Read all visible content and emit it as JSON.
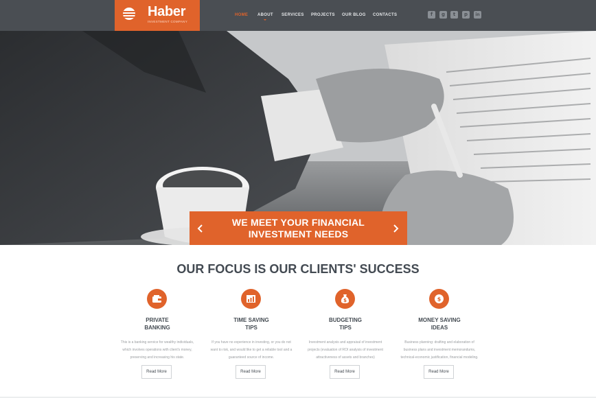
{
  "brand": {
    "name": "Haber",
    "tagline": "INVESTMENT COMPANY",
    "accent": "#e0632b",
    "header_bg": "#4a4e53"
  },
  "nav": [
    {
      "label": "HOME",
      "active": true
    },
    {
      "label": "ABOUT",
      "active": false
    },
    {
      "label": "SERVICES",
      "active": false
    },
    {
      "label": "PROJECTS",
      "active": false
    },
    {
      "label": "OUR BLOG",
      "active": false
    },
    {
      "label": "CONTACTS",
      "active": false
    }
  ],
  "social": [
    {
      "icon": "facebook-icon",
      "glyph": "f"
    },
    {
      "icon": "google-plus-icon",
      "glyph": "g"
    },
    {
      "icon": "twitter-icon",
      "glyph": "t"
    },
    {
      "icon": "pinterest-icon",
      "glyph": "p"
    },
    {
      "icon": "linkedin-icon",
      "glyph": "in"
    }
  ],
  "hero": {
    "line1": "WE MEET YOUR FINANCIAL",
    "line2": "INVESTMENT NEEDS",
    "prev_icon": "chevron-left-icon",
    "next_icon": "chevron-right-icon"
  },
  "focus": {
    "title": "OUR FOCUS IS OUR CLIENTS' SUCCESS",
    "items": [
      {
        "icon": "wallet-icon",
        "title1": "PRIVATE",
        "title2": "BANKING",
        "desc1": "This is a banking service for wealthy individuals,",
        "desc2": "which involves operations with client's money,",
        "desc3": "preserving and increasing his state.",
        "button": "Read More"
      },
      {
        "icon": "bar-chart-icon",
        "title1": "TIME SAVING",
        "title2": "TIPS",
        "desc1": "If you have no experience in investing, or you do not",
        "desc2": "want to risk, and would like to get a reliable tool and a",
        "desc3": "guaranteed source of income.",
        "button": "Read More"
      },
      {
        "icon": "money-bag-icon",
        "title1": "BUDGETING",
        "title2": "TIPS",
        "desc1": "Investment analysis and appraisal of investment",
        "desc2": "projects (evaluation of ROI analysis of investment",
        "desc3": "attractiveness of assets and branches)",
        "button": "Read More"
      },
      {
        "icon": "coin-icon",
        "title1": "MONEY SAVING",
        "title2": "IDEAS",
        "desc1": "Business planning: drafting and elaboration of",
        "desc2": "business plans and investment memorandums,",
        "desc3": "technical-economic justification, financial modeling.",
        "button": "Read More"
      }
    ]
  }
}
